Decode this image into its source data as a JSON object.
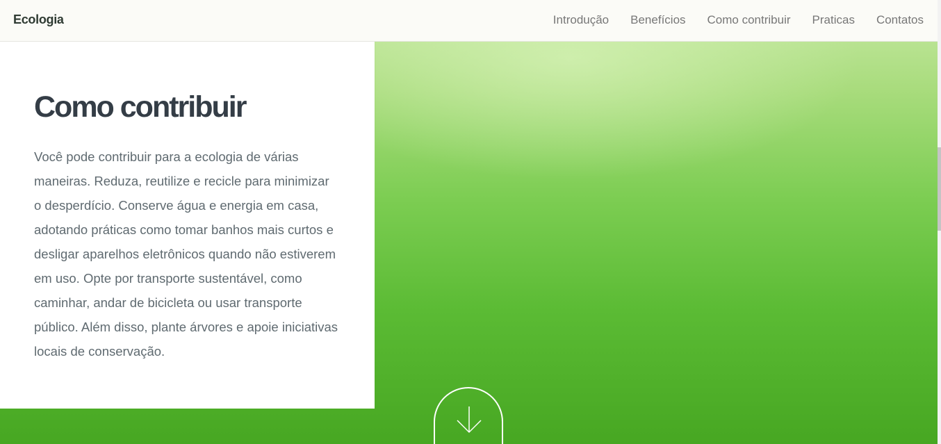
{
  "header": {
    "brand": "Ecologia",
    "nav": [
      {
        "label": "Introdução"
      },
      {
        "label": "Benefícios"
      },
      {
        "label": "Como contribuir"
      },
      {
        "label": "Praticas"
      },
      {
        "label": "Contatos"
      }
    ]
  },
  "section": {
    "title": "Como contribuir",
    "text": "Você pode contribuir para a ecologia de várias maneiras. Reduza, reutilize e recicle para minimizar o desperdício. Conserve água e energia em casa, adotando práticas como tomar banhos mais curtos e desligar aparelhos eletrônicos quando não estiverem em uso. Opte por transporte sustentável, como caminhar, andar de bicicleta ou usar transporte público. Além disso, plante árvores e apoie iniciativas locais de conservação."
  },
  "scroll_button": {
    "icon": "arrow-down-icon"
  },
  "colors": {
    "header_bg": "#fbfbf7",
    "brand": "#2f3b33",
    "nav_text": "#777777",
    "title": "#343d46",
    "body_text": "#5f6a70",
    "green_light": "#c6e9a3",
    "green_dark": "#47a722"
  }
}
